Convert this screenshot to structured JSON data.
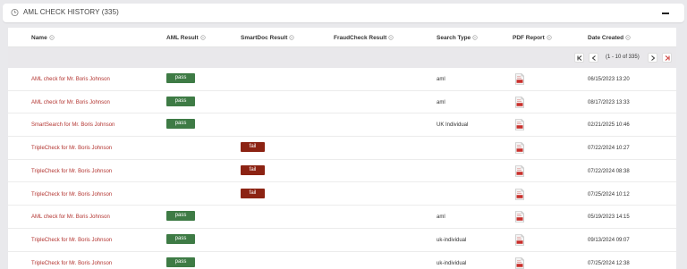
{
  "panel": {
    "title": "AML CHECK HISTORY (335)"
  },
  "table": {
    "columns": [
      "Name",
      "AML Result",
      "SmartDoc Result",
      "FraudCheck Result",
      "Search Type",
      "PDF Report",
      "Date Created"
    ],
    "pagination": {
      "info": "(1 - 10 of 335)"
    },
    "rows": [
      {
        "name": "AML check for Mr. Boris Johnson",
        "aml": "pass",
        "smartdoc": "",
        "fraudcheck": "",
        "search_type": "aml",
        "date": "06/15/2023 13:20"
      },
      {
        "name": "AML check for Mr. Boris Johnson",
        "aml": "pass",
        "smartdoc": "",
        "fraudcheck": "",
        "search_type": "aml",
        "date": "08/17/2023 13:33"
      },
      {
        "name": "SmartSearch for Mr. Boris Johnson",
        "aml": "pass",
        "smartdoc": "",
        "fraudcheck": "",
        "search_type": "UK Individual",
        "date": "02/21/2025 10:46"
      },
      {
        "name": "TripleCheck for Mr. Boris Johnson",
        "aml": "",
        "smartdoc": "fail",
        "fraudcheck": "",
        "search_type": "",
        "date": "07/22/2024 10:27"
      },
      {
        "name": "TripleCheck for Mr. Boris Johnson",
        "aml": "",
        "smartdoc": "fail",
        "fraudcheck": "",
        "search_type": "",
        "date": "07/22/2024 08:38"
      },
      {
        "name": "TripleCheck for Mr. Boris Johnson",
        "aml": "",
        "smartdoc": "fail",
        "fraudcheck": "",
        "search_type": "",
        "date": "07/25/2024 10:12"
      },
      {
        "name": "AML check for Mr. Boris Johnson",
        "aml": "pass",
        "smartdoc": "",
        "fraudcheck": "",
        "search_type": "aml",
        "date": "05/19/2023 14:15"
      },
      {
        "name": "TripleCheck for Mr. Boris Johnson",
        "aml": "pass",
        "smartdoc": "",
        "fraudcheck": "",
        "search_type": "uk-individual",
        "date": "09/13/2024 09:07"
      },
      {
        "name": "TripleCheck for Mr. Boris Johnson",
        "aml": "pass",
        "smartdoc": "",
        "fraudcheck": "",
        "search_type": "uk-individual",
        "date": "07/25/2024 12:38"
      }
    ]
  },
  "icons": {
    "panel": "history-icon",
    "collapse": "minus-icon",
    "sort": "sort-icon",
    "pdf": "pdf-file-icon",
    "first": "first-page-icon",
    "prev": "previous-page-icon",
    "next": "next-page-icon",
    "last": "last-page-icon"
  },
  "colors": {
    "pass": "#3e7b45",
    "fail": "#8c2313",
    "link": "#b2332f",
    "pdf": "#c9302c"
  }
}
